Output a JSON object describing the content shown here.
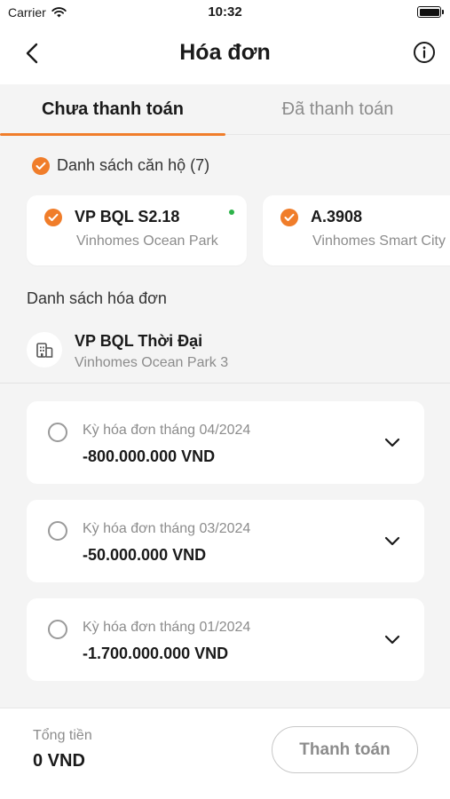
{
  "status_bar": {
    "carrier": "Carrier",
    "time": "10:32"
  },
  "nav": {
    "title": "Hóa đơn",
    "back_icon": "chevron-left-icon",
    "info_icon": "info-circle-icon"
  },
  "tabs": [
    {
      "label": "Chưa thanh toán",
      "active": true
    },
    {
      "label": "Đã thanh toán",
      "active": false
    }
  ],
  "apartments": {
    "header": "Danh sách căn hộ (7)",
    "items": [
      {
        "name": "VP BQL S2.18",
        "project": "Vinhomes Ocean Park",
        "selected": true,
        "online": true
      },
      {
        "name": "A.3908",
        "project": "Vinhomes Smart City",
        "selected": true,
        "online": false
      }
    ]
  },
  "invoices": {
    "title": "Danh sách hóa đơn",
    "building": {
      "name": "VP BQL Thời Đại",
      "project": "Vinhomes Ocean Park 3"
    },
    "items": [
      {
        "period": "Kỳ hóa đơn tháng 04/2024",
        "amount": "-800.000.000 VND"
      },
      {
        "period": "Kỳ hóa đơn tháng 03/2024",
        "amount": "-50.000.000 VND"
      },
      {
        "period": "Kỳ hóa đơn tháng 01/2024",
        "amount": "-1.700.000.000 VND"
      }
    ]
  },
  "footer": {
    "total_label": "Tổng tiền",
    "total_value": "0 VND",
    "pay_label": "Thanh toán"
  },
  "colors": {
    "accent": "#f07d2a",
    "online": "#2db34a",
    "muted": "#8c8c8c",
    "background": "#f4f4f4"
  }
}
